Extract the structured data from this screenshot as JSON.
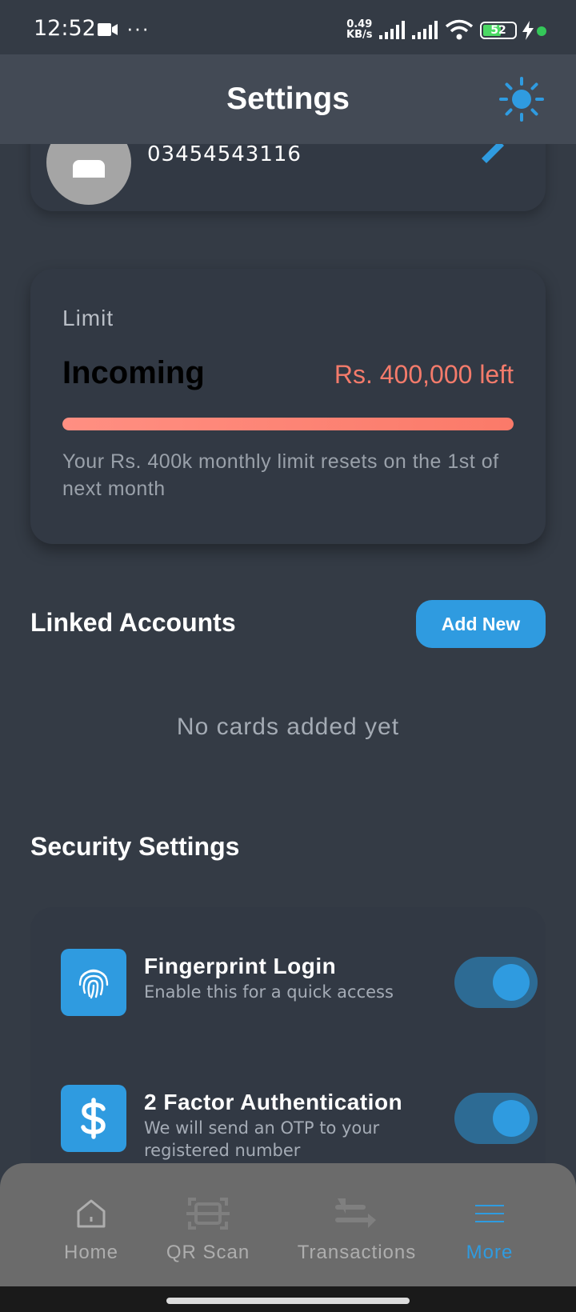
{
  "status_bar": {
    "time": "12:52",
    "dots": "···",
    "net_speed_value": "0.49",
    "net_speed_unit": "KB/s",
    "battery": "52"
  },
  "header": {
    "title": "Settings",
    "theme_icon": "sun-icon"
  },
  "profile": {
    "phone": "03454543116"
  },
  "limit": {
    "label": "Limit",
    "type": "Incoming",
    "remaining": "Rs. 400,000 left",
    "progress_fraction": 1.0,
    "note": "Your Rs. 400k monthly limit resets on the 1st of next month"
  },
  "linked_accounts": {
    "title": "Linked Accounts",
    "add_button": "Add New",
    "empty_text": "No cards added yet"
  },
  "security": {
    "title": "Security Settings",
    "items": [
      {
        "title": "Fingerprint Login",
        "description": "Enable this for a quick access",
        "icon": "fingerprint-icon",
        "enabled": true
      },
      {
        "title": "2 Factor Authentication",
        "description": "We will send an OTP to your registered number",
        "icon": "dollar-icon",
        "enabled": true
      }
    ]
  },
  "bottom_nav": {
    "items": [
      {
        "label": "Home",
        "icon": "home-icon",
        "active": false
      },
      {
        "label": "QR Scan",
        "icon": "qr-scan-icon",
        "active": false
      },
      {
        "label": "Transactions",
        "icon": "transactions-icon",
        "active": false
      },
      {
        "label": "More",
        "icon": "menu-icon",
        "active": true
      }
    ]
  },
  "colors": {
    "background": "#343b45",
    "header": "#434a55",
    "accent": "#2f9be0",
    "limit_text": "#f47b6b",
    "nav_background": "#6b6b6b"
  }
}
